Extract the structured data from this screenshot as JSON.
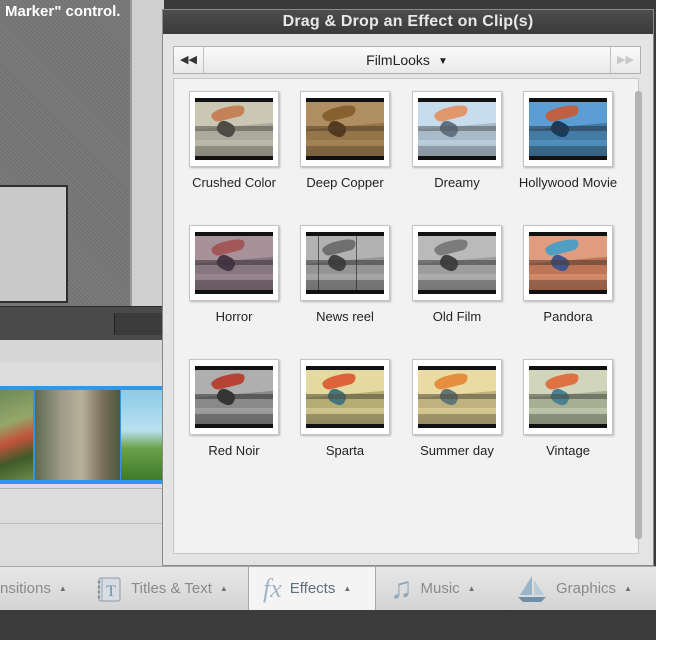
{
  "window": {
    "monitor_text": "Marker\" control."
  },
  "panel": {
    "title": "Drag & Drop an Effect on Clip(s)",
    "back_glyph": "◀◀",
    "forward_glyph": "▶▶",
    "category": "FilmLooks",
    "category_caret": "▼"
  },
  "effects": [
    {
      "label": "Crushed Color",
      "sky": "#c9c7b8",
      "hill": "#9fa099",
      "glider": "#c06a3c",
      "pilot": "#222222",
      "tint": "rgba(210,200,170,0.25)"
    },
    {
      "label": "Deep Copper",
      "sky": "#b7a27c",
      "hill": "#8f7a58",
      "glider": "#7a5a30",
      "pilot": "#2b2013",
      "tint": "rgba(160,110,50,0.35)"
    },
    {
      "label": "Dreamy",
      "sky": "#bcd6e6",
      "hill": "#93a8b5",
      "glider": "#e0783a",
      "pilot": "#33475a",
      "tint": "rgba(230,240,255,0.25)"
    },
    {
      "label": "Hollywood Movie",
      "sky": "#6aa8d6",
      "hill": "#4a7c9c",
      "glider": "#e65a22",
      "pilot": "#152b40",
      "tint": "rgba(40,120,200,0.2)"
    },
    {
      "label": "Horror",
      "sky": "#b8a9a8",
      "hill": "#8b8485",
      "glider": "#b05a52",
      "pilot": "#3a2f3a",
      "tint": "rgba(120,80,110,0.25)"
    },
    {
      "label": "News reel",
      "sky": "#bfbfbf",
      "hill": "#9a9a9a",
      "glider": "#6b6b6b",
      "pilot": "#333333",
      "tint": "rgba(128,128,128,0.2)",
      "scratched": true
    },
    {
      "label": "Old Film",
      "sky": "#c6c6c6",
      "hill": "#a2a2a2",
      "glider": "#777777",
      "pilot": "#2f2f2f",
      "tint": "rgba(140,140,140,0.2)"
    },
    {
      "label": "Pandora",
      "sky": "#e2a58a",
      "hill": "#b67558",
      "glider": "#2fa8e0",
      "pilot": "#1d4e9a",
      "tint": "rgba(220,120,80,0.2)"
    },
    {
      "label": "Red Noir",
      "sky": "#b9b9b9",
      "hill": "#8c8c8c",
      "glider": "#c23a2a",
      "pilot": "#2a2a2a",
      "tint": "rgba(120,120,120,0.15)"
    },
    {
      "label": "Sparta",
      "sky": "#e2d9a8",
      "hill": "#a7a276",
      "glider": "#d9452b",
      "pilot": "#1f5c7e",
      "tint": "rgba(240,220,120,0.2)"
    },
    {
      "label": "Summer day",
      "sky": "#e6d9a6",
      "hill": "#b2a678",
      "glider": "#e0782a",
      "pilot": "#3d5a6e",
      "tint": "rgba(250,230,150,0.2)"
    },
    {
      "label": "Vintage",
      "sky": "#d2d6c0",
      "hill": "#9ea68e",
      "glider": "#e45b2a",
      "pilot": "#2b6c8a",
      "tint": "rgba(200,210,170,0.2)"
    }
  ],
  "tabs": {
    "transitions": {
      "label": "nsitions",
      "caret": "▲"
    },
    "titles": {
      "label": "Titles & Text",
      "caret": "▲",
      "icon_glyph": "T"
    },
    "effects": {
      "label": "Effects",
      "caret": "▲",
      "icon_glyph": "fx"
    },
    "music": {
      "label": "Music",
      "caret": "▲",
      "icon_glyph": "♫"
    },
    "graphics": {
      "label": "Graphics",
      "caret": "▲"
    }
  },
  "colors": {
    "accent_blue": "#2f97e8",
    "panel_header": "#3a3a3a",
    "tab_active_text": "#5d6f7d"
  }
}
